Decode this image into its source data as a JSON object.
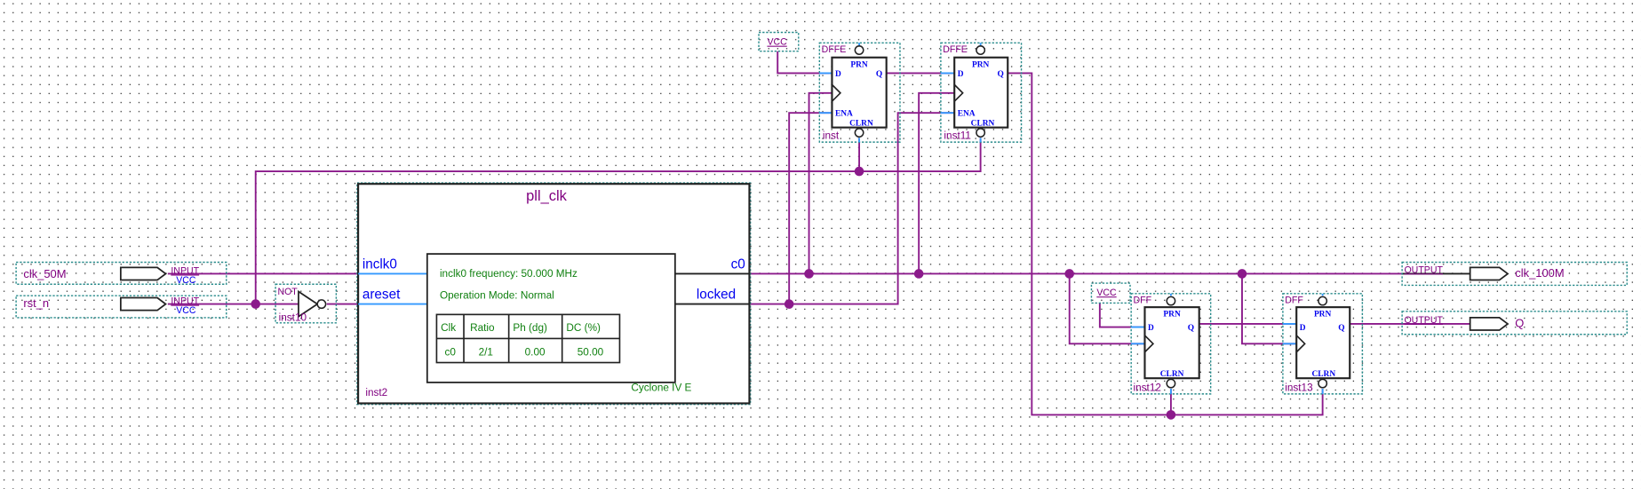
{
  "colors": {
    "wire": "#8b1a8b",
    "port_wire": "#3399ff",
    "instance_border": "#2a8c8c",
    "pin_label": "#0000ee",
    "pll_info": "#108010",
    "name_label": "#800080"
  },
  "inputs": [
    {
      "name": "clk_50M",
      "type": "INPUT",
      "default": "VCC"
    },
    {
      "name": "rst_n",
      "type": "INPUT",
      "default": "VCC"
    }
  ],
  "outputs": [
    {
      "name": "clk_100M",
      "type": "OUTPUT"
    },
    {
      "name": "Q",
      "type": "OUTPUT"
    }
  ],
  "not_gate": {
    "type": "NOT",
    "instance": "inst10"
  },
  "pll": {
    "title": "pll_clk",
    "instance": "inst2",
    "ports": {
      "inclk0": "inclk0",
      "areset": "areset",
      "c0": "c0",
      "locked": "locked"
    },
    "frequency": "inclk0 frequency: 50.000 MHz",
    "mode": "Operation Mode: Normal",
    "table": {
      "headers": [
        "Clk",
        "Ratio",
        "Ph (dg)",
        "DC (%)"
      ],
      "rows": [
        [
          "c0",
          "2/1",
          "0.00",
          "50.00"
        ]
      ]
    },
    "device": "Cyclone IV E"
  },
  "vcc": [
    "VCC",
    "VCC"
  ],
  "flipflops": [
    {
      "type": "DFFE",
      "instance": "inst",
      "pins": {
        "d": "D",
        "q": "Q",
        "prn": "PRN",
        "ena": "ENA",
        "clrn": "CLRN"
      }
    },
    {
      "type": "DFFE",
      "instance": "inst11",
      "pins": {
        "d": "D",
        "q": "Q",
        "prn": "PRN",
        "ena": "ENA",
        "clrn": "CLRN"
      }
    },
    {
      "type": "DFF",
      "instance": "inst12",
      "pins": {
        "d": "D",
        "q": "Q",
        "prn": "PRN",
        "clrn": "CLRN"
      }
    },
    {
      "type": "DFF",
      "instance": "inst13",
      "pins": {
        "d": "D",
        "q": "Q",
        "prn": "PRN",
        "clrn": "CLRN"
      }
    }
  ]
}
